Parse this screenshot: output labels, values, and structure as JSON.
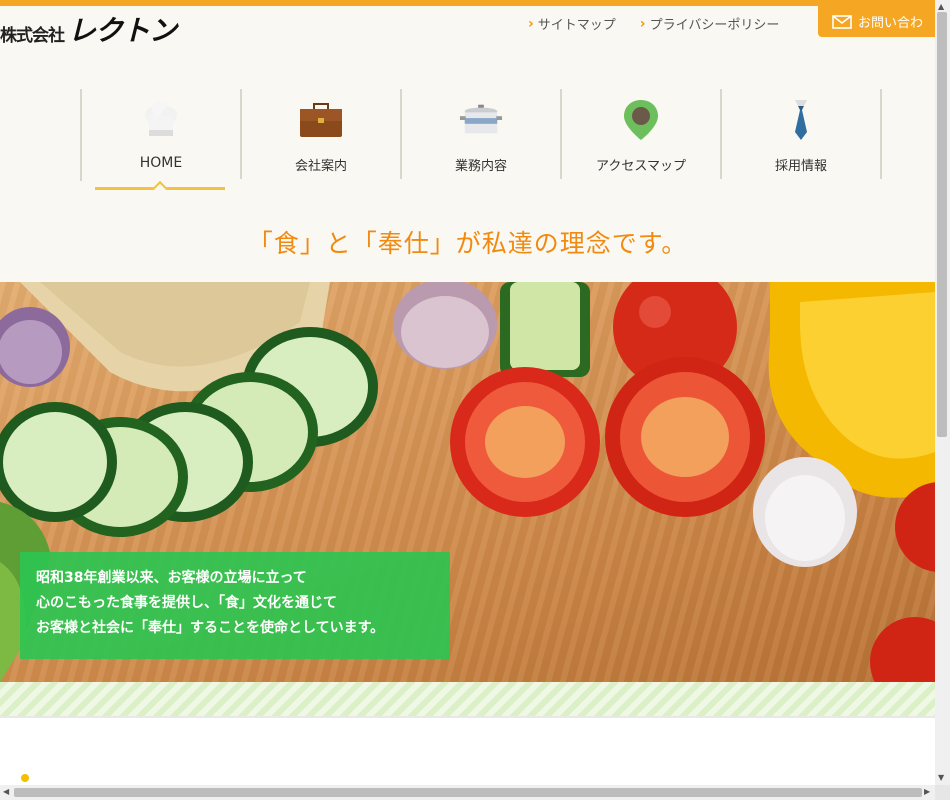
{
  "header": {
    "logo_prefix": "株式会社",
    "logo_main": "レクトン",
    "util_links": [
      "サイトマップ",
      "プライバシーポリシー"
    ],
    "contact_label": "お問い合わ"
  },
  "nav": {
    "items": [
      {
        "label": "HOME",
        "icon": "chef-hat-icon"
      },
      {
        "label": "会社案内",
        "icon": "briefcase-icon"
      },
      {
        "label": "業務内容",
        "icon": "pot-icon"
      },
      {
        "label": "アクセスマップ",
        "icon": "map-pin-icon"
      },
      {
        "label": "採用情報",
        "icon": "necktie-icon"
      }
    ],
    "active": "HOME"
  },
  "tagline": "「食」と「奉仕」が私達の理念です。",
  "hero": {
    "caption_lines": [
      "昭和38年創業以来、お客様の立場に立って",
      "心のこもった食事を提供し、「食」文化を通じて",
      "お客様と社会に「奉仕」することを使命としています。"
    ]
  },
  "colors": {
    "accent": "#f5a623",
    "tagline": "#f08a10",
    "caption_bg": "#2ec450",
    "underline": "#f3c242"
  }
}
